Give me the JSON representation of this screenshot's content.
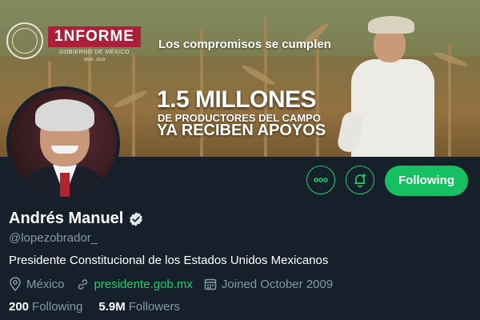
{
  "banner": {
    "logo_title": "1NFORME",
    "logo_subtitle": "GOBIERNO DE MÉXICO",
    "logo_years": "2018 - 2019",
    "tagline": "Los compromisos se cumplen",
    "headline_1": "1.5 MILLONES",
    "headline_2": "DE PRODUCTORES DEL CAMPO",
    "headline_3": "YA RECIBEN APOYOS"
  },
  "actions": {
    "more_icon": "more-dots-icon",
    "notify_icon": "bell-plus-icon",
    "follow_label": "Following"
  },
  "profile": {
    "name": "Andrés Manuel",
    "handle": "@lopezobrador_",
    "bio": "Presidente Constitucional de los Estados Unidos Mexicanos",
    "location": "México",
    "website": "presidente.gob.mx",
    "joined": "Joined October 2009"
  },
  "stats": {
    "following_count": "200",
    "following_label": "Following",
    "followers_count": "5.9M",
    "followers_label": "Followers"
  },
  "colors": {
    "background": "#15202b",
    "accent": "#17bf63",
    "muted_text": "#8899a6",
    "informe_red": "#a8203a"
  }
}
